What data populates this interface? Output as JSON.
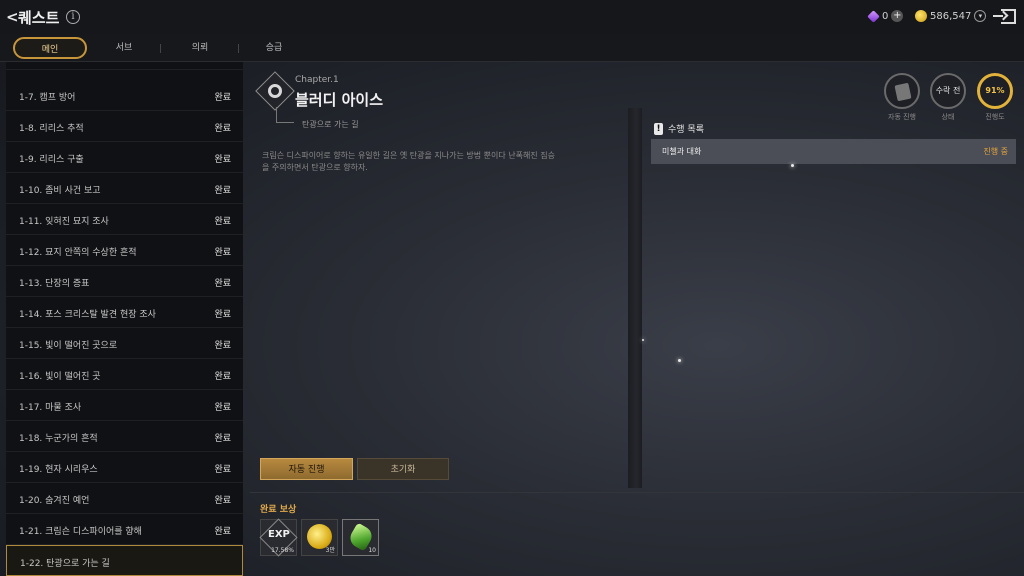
{
  "header": {
    "back_label": "<",
    "title": "퀘스트",
    "info_label": "i",
    "gem_count": "0",
    "gem_plus": "+",
    "gold_amount": "586,547",
    "gold_dropdown": "▾"
  },
  "tabs": [
    {
      "label": "메인",
      "active": true
    },
    {
      "label": "서브",
      "active": false
    },
    {
      "label": "의뢰",
      "active": false
    },
    {
      "label": "승급",
      "active": false
    }
  ],
  "quest_list": [
    {
      "name": "1-7. 캠프 방어",
      "status": "완료"
    },
    {
      "name": "1-8. 리리스 추적",
      "status": "완료"
    },
    {
      "name": "1-9. 리리스 구출",
      "status": "완료"
    },
    {
      "name": "1-10. 좀비 사건 보고",
      "status": "완료"
    },
    {
      "name": "1-11. 잊혀진 묘지 조사",
      "status": "완료"
    },
    {
      "name": "1-12. 묘지 안쪽의 수상한 흔적",
      "status": "완료"
    },
    {
      "name": "1-13. 단장의 증표",
      "status": "완료"
    },
    {
      "name": "1-14. 포스 크리스탈 발견 현장 조사",
      "status": "완료"
    },
    {
      "name": "1-15. 빛이 떨어진 곳으로",
      "status": "완료"
    },
    {
      "name": "1-16. 빛이 떨어진 곳",
      "status": "완료"
    },
    {
      "name": "1-17. 마물 조사",
      "status": "완료"
    },
    {
      "name": "1-18. 누군가의 흔적",
      "status": "완료"
    },
    {
      "name": "1-19. 현자 시리우스",
      "status": "완료"
    },
    {
      "name": "1-20. 숨겨진 예언",
      "status": "완료"
    },
    {
      "name": "1-21. 크림슨 디스파이어를 향해",
      "status": "완료"
    },
    {
      "name": "1-22. 탄광으로 가는 길",
      "status": ""
    }
  ],
  "quest_detail": {
    "chapter": "Chapter.1",
    "title": "블러디 아이스",
    "subtitle": "탄광으로 가는 길",
    "description": "크림슨 디스파이어로 향하는 유일한 길은 옛 탄광을 지나가는 방법 뿐이다 난폭해진 짐승을 주의하면서 탄광으로 향하자."
  },
  "buttons": {
    "auto": "자동 진행",
    "reset": "초기화"
  },
  "status_circles": [
    {
      "value": "",
      "label": "자동 진행"
    },
    {
      "value": "수락 전",
      "label": "상태"
    },
    {
      "value": "91%",
      "label": "진행도"
    }
  ],
  "task_list": {
    "title": "수행 목록",
    "items": [
      {
        "name": "미첼과 대화",
        "status": "진행 중"
      }
    ]
  },
  "rewards": {
    "title": "완료 보상",
    "items": [
      {
        "icon": "exp-icon",
        "label": "EXP",
        "count": "17.58%"
      },
      {
        "icon": "gold-coin-icon",
        "count": "3만"
      },
      {
        "icon": "green-gem-icon",
        "count": "10"
      }
    ]
  },
  "colors": {
    "accent_gold": "#c8963a",
    "in_progress": "#e6a53a",
    "progress_ring": "#e2b23a"
  }
}
